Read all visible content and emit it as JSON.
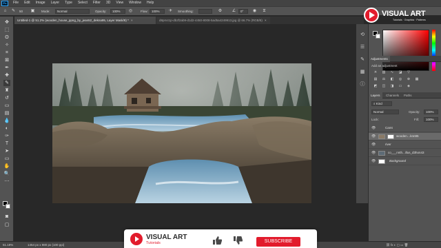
{
  "menubar": {
    "logo": "Ps",
    "items": [
      "File",
      "Edit",
      "Image",
      "Layer",
      "Type",
      "Select",
      "Filter",
      "3D",
      "View",
      "Window",
      "Help"
    ]
  },
  "options": {
    "brush_size": "50",
    "mode_label": "Mode:",
    "mode_value": "Normal",
    "opacity_label": "Opacity:",
    "opacity_value": "100%",
    "flow_label": "Flow:",
    "flow_value": "100%",
    "smoothing_label": "Smoothing:",
    "angle_value": "0°"
  },
  "tabs": [
    {
      "label": "Untitled-1 @ 51.2% (wooden_house_ppng_by_jean52_dekna95, Layer Mask/8) *"
    },
    {
      "label": "d8pm41p-db2f2ab9-d1d2-4450-8008-5ad5a4249913.jpg @ 66.7% (RGB/8)"
    }
  ],
  "status": {
    "zoom": "51.19%",
    "doc_size": "1454 px x 980 px (100 ppi)"
  },
  "watermark": {
    "title": "VISUAL ART",
    "subtitle": "Tutorials · Graphics · Patterns"
  },
  "panels": {
    "adjustments_title": "Adjustments",
    "add_adjustment": "Add an adjustment",
    "layers_tabs": [
      "Layers",
      "Channels",
      "Paths"
    ],
    "kind_label": "Kind",
    "blend_mode": "Normal",
    "opacity_label": "Opacity:",
    "opacity_value": "100%",
    "lock_label": "Lock:",
    "fill_label": "Fill:",
    "fill_value": "100%",
    "layers": [
      {
        "name": "Camt"
      },
      {
        "name": "wooden…knn95"
      },
      {
        "name": "river"
      },
      {
        "name": "co___nnth...illus_d3hon43"
      },
      {
        "name": "Background"
      }
    ]
  },
  "promo": {
    "title": "VISUAL ART",
    "subtitle": "Tutorials",
    "subscribe_label": "SUBSCRIBE"
  },
  "colors": {
    "brand_red": "#e21b2c",
    "ps_blue": "#31a8ff"
  }
}
